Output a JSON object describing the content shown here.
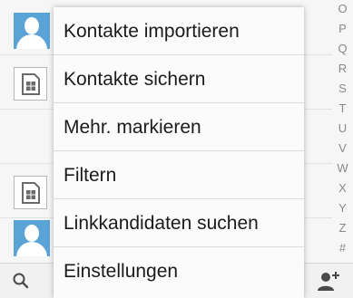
{
  "index_letters": [
    "O",
    "P",
    "Q",
    "R",
    "S",
    "T",
    "U",
    "V",
    "W",
    "X",
    "Y",
    "Z",
    "#"
  ],
  "menu": {
    "items": [
      {
        "label": "Kontakte importieren"
      },
      {
        "label": "Kontakte sichern"
      },
      {
        "label": "Mehr. markieren"
      },
      {
        "label": "Filtern"
      },
      {
        "label": "Linkkandidaten suchen"
      },
      {
        "label": "Einstellungen"
      }
    ]
  },
  "icons": {
    "search": "search-icon",
    "add_contact": "add-contact-icon",
    "avatar": "person-silhouette-icon",
    "sim": "sim-card-icon"
  },
  "colors": {
    "avatar_bg": "#5aa3d6",
    "menu_bg": "#fbfbfb",
    "divider": "#dcdcdc"
  }
}
